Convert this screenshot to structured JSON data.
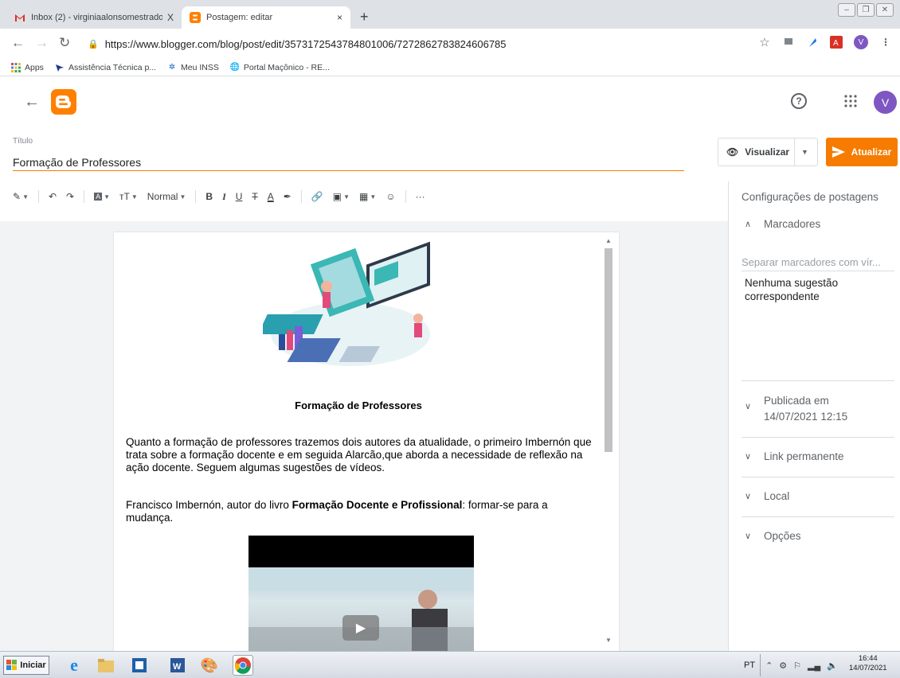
{
  "tabs": [
    {
      "title": "Inbox (2) - virginiaalonsomestrado...",
      "close": "X"
    },
    {
      "title": "Postagem: editar",
      "close": "×"
    }
  ],
  "new_tab": "+",
  "address": {
    "url": "https://www.blogger.com/blog/post/edit/3573172543784801006/7272862783824606785"
  },
  "bookmarks": [
    "Apps",
    "Assistência Técnica p...",
    "Meu INSS",
    "Portal Maçônico - RE..."
  ],
  "profile_initial": "V",
  "editor": {
    "title_label": "Título",
    "title_value": "Formação de Professores",
    "preview_label": "Visualizar",
    "update_label": "Atualizar",
    "toolbar": {
      "style_select": "Normal"
    }
  },
  "post": {
    "heading": "Formação de Professores",
    "paragraph1": "Quanto a formação de professores trazemos dois autores  da atualidade, o primeiro Imbernón que trata sobre a formação docente e em seguida Alarcão,que aborda a necessidade de reflexão na ação docente. Seguem algumas sugestões de vídeos.",
    "paragraph2_prefix": "Francisco Imbernón, autor do livro ",
    "paragraph2_bold": "Formação Docente e Profissional",
    "paragraph2_suffix": ": formar-se para a mudança."
  },
  "sidebar": {
    "title": "Configurações de postagens",
    "labels_heading": "Marcadores",
    "labels_placeholder": "Separar marcadores com vír...",
    "no_suggestion": "Nenhuma sugestão correspondente",
    "published_label": "Publicada em",
    "published_date": "14/07/2021 12:15",
    "permalink": "Link permanente",
    "location": "Local",
    "options": "Opções"
  },
  "taskbar": {
    "start": "Iniciar",
    "lang": "PT",
    "time": "16:44",
    "date": "14/07/2021"
  },
  "colors": {
    "accent": "#f57c00",
    "blogger_orange": "#ff8000",
    "avatar": "#7e57c2"
  }
}
